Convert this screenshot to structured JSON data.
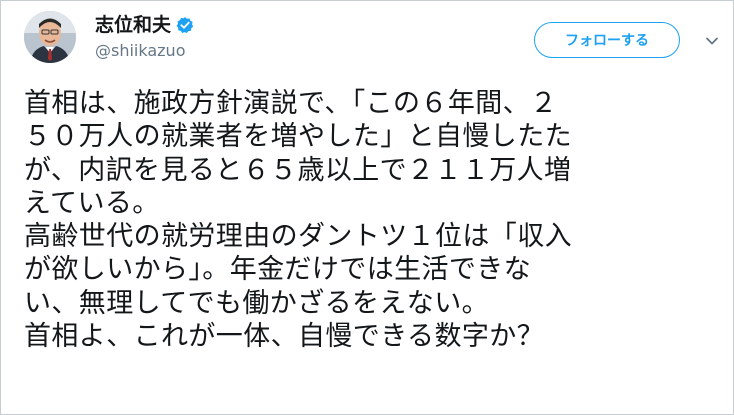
{
  "author": {
    "display_name": "志位和夫",
    "handle": "@shiikazuo",
    "verified": true,
    "avatar_icon": "avatar-portrait"
  },
  "follow_button": {
    "label": "フォローする"
  },
  "menu_icon": "chevron-down-icon",
  "tweet": {
    "lines": [
      "首相は、施政方針演説で、「この６年間、２",
      "５０万人の就業者を増やした」と自慢したた",
      "が、内訳を見ると６５歳以上で２１１万人増",
      "えている。",
      "高齢世代の就労理由のダントツ１位は「収入",
      "が欲しいから」。年金だけでは生活できな",
      "い、無理してでも働かざるをえない。",
      "首相よ、これが一体、自慢できる数字か？"
    ]
  },
  "colors": {
    "accent": "#1da1f2",
    "text": "#14171a",
    "secondary": "#657786",
    "border": "#c8cdd1"
  }
}
